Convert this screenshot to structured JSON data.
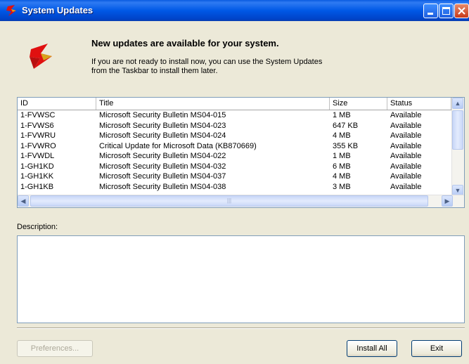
{
  "window": {
    "title": "System Updates"
  },
  "header": {
    "heading": "New updates are available for your system.",
    "subtext_line1": "If you are not ready to install now, you can use the System Updates",
    "subtext_line2": "from the Taskbar to install them later."
  },
  "updates_table": {
    "columns": [
      "ID",
      "Title",
      "Size",
      "Status"
    ],
    "rows": [
      {
        "id": "1-FVWSC",
        "title": "Microsoft Security Bulletin MS04-015",
        "size": "1 MB",
        "status": "Available"
      },
      {
        "id": "1-FVWS6",
        "title": "Microsoft Security Bulletin MS04-023",
        "size": "647 KB",
        "status": "Available"
      },
      {
        "id": "1-FVWRU",
        "title": "Microsoft Security Bulletin MS04-024",
        "size": "4 MB",
        "status": "Available"
      },
      {
        "id": "1-FVWRO",
        "title": "Critical Update for Microsoft Data (KB870669)",
        "size": "355 KB",
        "status": "Available"
      },
      {
        "id": "1-FVWDL",
        "title": "Microsoft Security Bulletin MS04-022",
        "size": "1 MB",
        "status": "Available"
      },
      {
        "id": "1-GH1KD",
        "title": "Microsoft Security Bulletin MS04-032",
        "size": "6 MB",
        "status": "Available"
      },
      {
        "id": "1-GH1KK",
        "title": "Microsoft Security Bulletin MS04-037",
        "size": "4 MB",
        "status": "Available"
      },
      {
        "id": "1-GH1KB",
        "title": "Microsoft Security Bulletin MS04-038",
        "size": "3 MB",
        "status": "Available"
      }
    ]
  },
  "description": {
    "label": "Description:",
    "text": ""
  },
  "buttons": {
    "preferences": "Preferences...",
    "install_all": "Install All",
    "exit": "Exit"
  },
  "colors": {
    "title_bar": "#0058e6",
    "face": "#ece9d8",
    "border": "#7f9db9",
    "logo_red": "#e01010",
    "logo_gold": "#d8a21a"
  }
}
